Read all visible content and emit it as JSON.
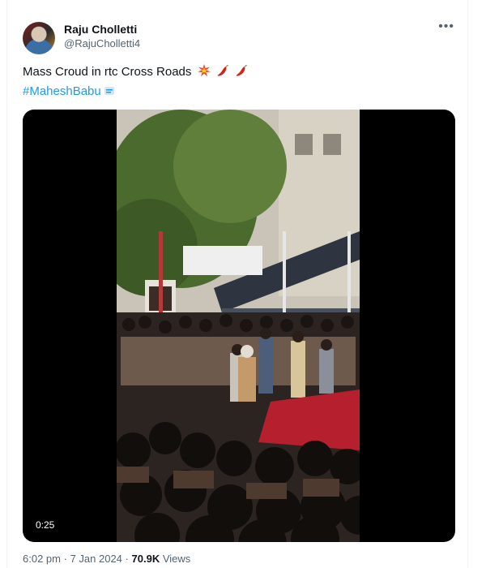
{
  "author": {
    "display_name": "Raju Cholletti",
    "handle": "@RajuCholletti4"
  },
  "menu_icon": "more-horizontal-icon",
  "post": {
    "text": "Mass Croud in rtc Cross Roads",
    "emojis": [
      "collision-icon",
      "hot-pepper-icon",
      "hot-pepper-icon"
    ],
    "hashtag": "#MaheshBabu"
  },
  "video": {
    "duration": "0:25"
  },
  "meta": {
    "time": "6:02 pm",
    "separator": "·",
    "date": "7 Jan 2024",
    "separator2": "·",
    "views_count": "70.9K",
    "views_label": "Views"
  },
  "colors": {
    "link": "#1d9bf0",
    "secondary_text": "#536471",
    "primary_text": "#0f1419"
  }
}
